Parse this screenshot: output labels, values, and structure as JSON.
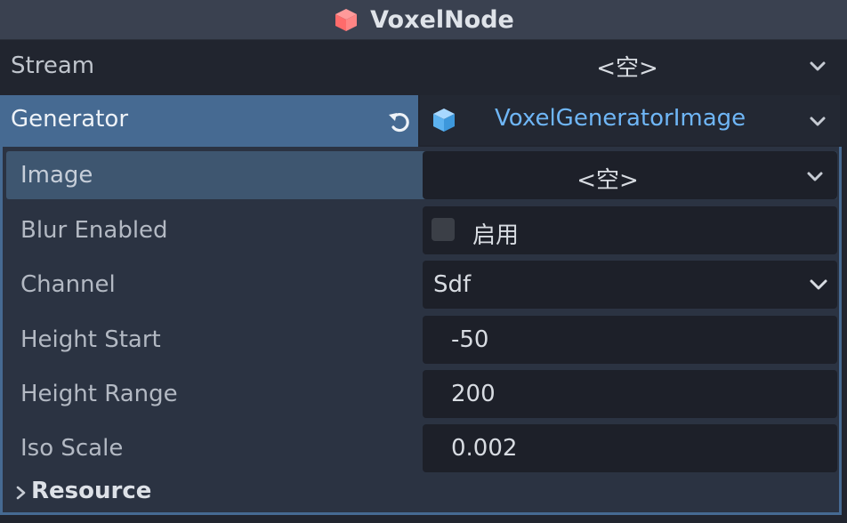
{
  "header": {
    "title": "VoxelNode",
    "icon": "voxel-node-icon"
  },
  "stream": {
    "label": "Stream",
    "value": "<空>"
  },
  "generator": {
    "label": "Generator",
    "value": "VoxelGeneratorImage",
    "accent": "#6fb6f6"
  },
  "properties": {
    "image": {
      "label": "Image",
      "value": "<空>"
    },
    "blur_enabled": {
      "label": "Blur Enabled",
      "checkbox_label": "启用",
      "checked": false
    },
    "channel": {
      "label": "Channel",
      "value": "Sdf"
    },
    "height_start": {
      "label": "Height Start",
      "value": "-50"
    },
    "height_range": {
      "label": "Height Range",
      "value": "200"
    },
    "iso_scale": {
      "label": "Iso Scale",
      "value": "0.002"
    }
  },
  "resource": {
    "label": "Resource"
  },
  "colors": {
    "selected_row": "#466a92",
    "panel": "#2b3342",
    "field": "#1d2029"
  }
}
